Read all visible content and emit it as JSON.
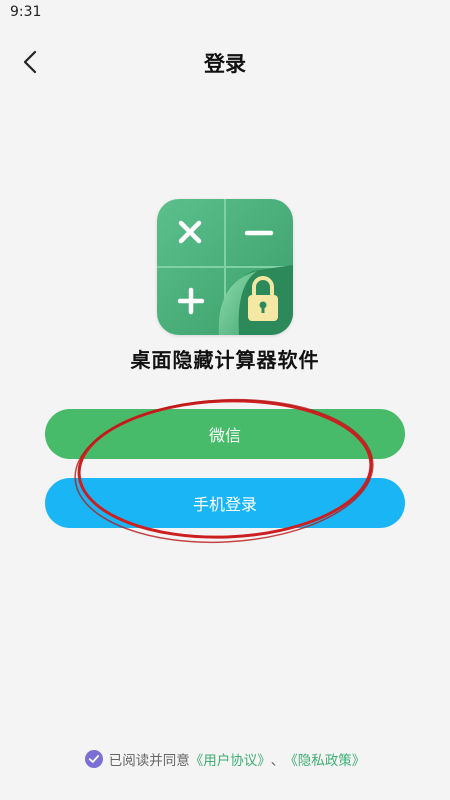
{
  "status_bar": {
    "time": "9:31"
  },
  "header": {
    "title": "登录",
    "back_icon": "chevron-left-icon"
  },
  "app": {
    "name": "桌面隐藏计算器软件",
    "icon": "calculator-lock-icon",
    "colors": {
      "icon_bg": "#52b882",
      "icon_dark": "#2f8f5e"
    }
  },
  "buttons": {
    "wechat_label": "微信",
    "phone_label": "手机登录",
    "colors": {
      "wechat": "#47bb6a",
      "phone": "#1ab5f5"
    }
  },
  "agreement": {
    "prefix": "已阅读并同意",
    "user_agreement": "《用户协议》",
    "separator": "、",
    "privacy_policy": "《隐私政策》",
    "checked": true,
    "colors": {
      "check": "#7b6fd6",
      "link": "#3fae74"
    }
  },
  "annotation": {
    "shape": "red-ellipse",
    "color": "#cc1f1f"
  }
}
